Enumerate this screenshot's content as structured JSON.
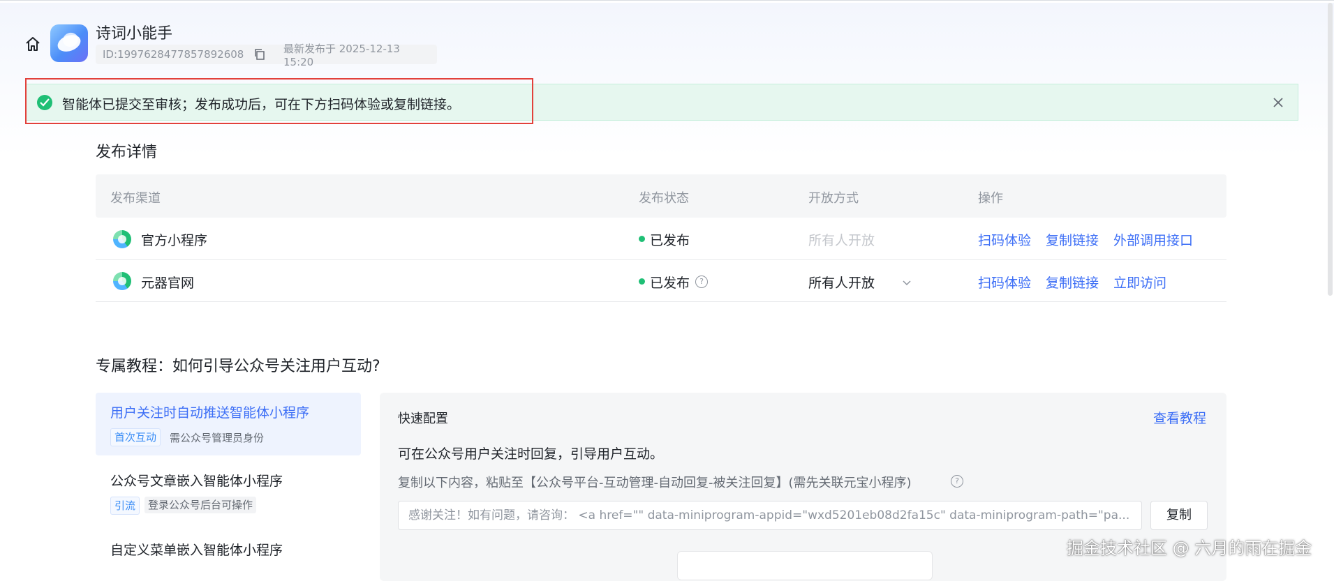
{
  "header": {
    "app_name": "诗词小能手",
    "id_text": "ID:1997628477857892608",
    "last_published": "最新发布于 2025-12-13 15:20"
  },
  "alert": {
    "message": "智能体已提交至审核；发布成功后，可在下方扫码体验或复制链接。"
  },
  "publish_details": {
    "title": "发布详情",
    "columns": [
      "发布渠道",
      "发布状态",
      "开放方式",
      "操作"
    ],
    "rows": [
      {
        "channel": "官方小程序",
        "status": "已发布",
        "access": "所有人开放",
        "actions": [
          "扫码体验",
          "复制链接",
          "外部调用接口"
        ]
      },
      {
        "channel": "元器官网",
        "status": "已发布",
        "access": "所有人开放",
        "actions": [
          "扫码体验",
          "复制链接",
          "立即访问"
        ]
      }
    ]
  },
  "tutorial": {
    "title": "专属教程：如何引导公众号关注用户互动?",
    "items": [
      {
        "title": "用户关注时自动推送智能体小程序",
        "tag": "首次互动",
        "note": "需公众号管理员身份"
      },
      {
        "title": "公众号文章嵌入智能体小程序",
        "tag": "引流",
        "note": "登录公众号后台可操作"
      },
      {
        "title": "自定义菜单嵌入智能体小程序"
      }
    ],
    "panel": {
      "title": "快速配置",
      "link": "查看教程",
      "description": "可在公众号用户关注时回复，引导用户互动。",
      "hint": "复制以下内容，粘贴至【公众号平台-互动管理-自动回复-被关注回复】(需先关联元宝小程序)",
      "snippet": "感谢关注！如有问题，请咨询：  <a href=\"\" data-miniprogram-appid=\"wxd5201eb08d2fa15c\" data-miniprogram-path=\"pa...",
      "copy_button": "复制"
    }
  },
  "watermark": "掘金技术社区 @ 六月的雨在掘金",
  "colors": {
    "accent": "#3c6ef6",
    "success": "#1fbf75",
    "alert_bg": "#e6f7ef",
    "highlight": "#e2413b"
  }
}
